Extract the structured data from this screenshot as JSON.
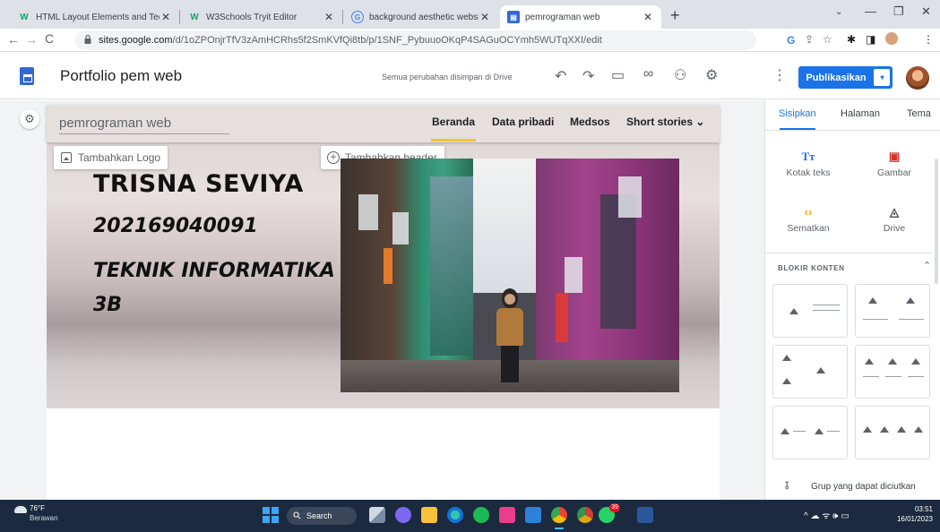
{
  "browser": {
    "tabs": [
      {
        "title": "HTML Layout Elements and Tech",
        "favicon": "w3schools-icon"
      },
      {
        "title": "W3Schools Tryit Editor",
        "favicon": "w3schools-icon"
      },
      {
        "title": "background aesthetic website bl",
        "favicon": "google-icon"
      },
      {
        "title": "pemrograman web",
        "favicon": "google-sites-icon"
      }
    ],
    "new_tab": "+",
    "url_host": "sites.google.com",
    "url_path": "/d/1oZPOnjrTfV3zAmHCRhs5f2SmKVfQi8tb/p/1SNF_PybuuoOKqP4SAGuOCYmh5WUTqXXI/edit"
  },
  "sites_header": {
    "title": "Portfolio pem web",
    "save_status": "Semua perubahan disimpan di Drive",
    "publish_label": "Publikasikan"
  },
  "site": {
    "name": "pemrograman web",
    "menu": [
      "Beranda",
      "Data pribadi",
      "Medsos",
      "Short stories"
    ],
    "add_logo": "Tambahkan Logo",
    "add_header": "Tambahkan header",
    "hero_name": "TRISNA SEVIYA",
    "hero_id": "202169040091",
    "hero_major": "TEKNIK INFORMATIKA",
    "hero_class": "3B"
  },
  "right_panel": {
    "tabs": [
      "Sisipkan",
      "Halaman",
      "Tema"
    ],
    "insert_items": [
      {
        "label": "Kotak teks",
        "icon": "text-box-icon"
      },
      {
        "label": "Gambar",
        "icon": "image-icon"
      },
      {
        "label": "Sematkan",
        "icon": "embed-icon"
      },
      {
        "label": "Drive",
        "icon": "drive-icon"
      }
    ],
    "blocks_title": "BLOKIR KONTEN",
    "group_label": "Grup yang dapat diciutkan"
  },
  "taskbar": {
    "temp": "76°F",
    "condition": "Berawan",
    "search": "Search",
    "badge": "39",
    "time": "03:51",
    "date": "16/01/2023"
  },
  "colors": {
    "accent": "#1a73e8",
    "menu_underline": "#f4c430",
    "taskbar": "#1b2a3f"
  }
}
